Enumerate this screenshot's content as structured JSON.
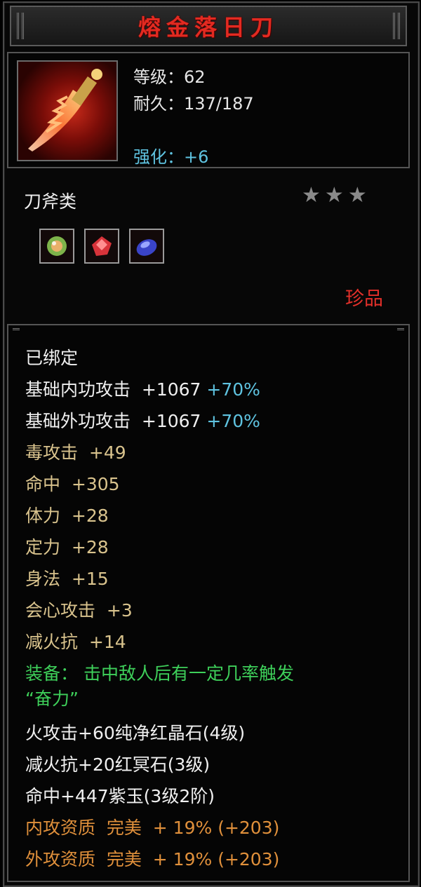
{
  "item": {
    "name": "熔金落日刀",
    "level_line": "等级：62",
    "durability_line": "耐久：137/187",
    "enhance_line": "强化：+6",
    "category": "刀斧类",
    "star_count": 3,
    "rarity": "珍品",
    "gems": [
      {
        "icon": "green-round-gem-icon",
        "color": "#7db34a"
      },
      {
        "icon": "red-crystal-gem-icon",
        "color": "#d8333a"
      },
      {
        "icon": "purple-jade-gem-icon",
        "color": "#4a5be0"
      }
    ]
  },
  "attributes": [
    {
      "text": "已绑定",
      "color": "white"
    },
    {
      "text": "基础内功攻击  +1067",
      "extra": "+70%",
      "color": "white"
    },
    {
      "text": "基础外功攻击  +1067",
      "extra": "+70%",
      "color": "white"
    },
    {
      "text": "毒攻击  +49",
      "color": "tan"
    },
    {
      "text": "命中  +305",
      "color": "tan"
    },
    {
      "text": "体力  +28",
      "color": "tan"
    },
    {
      "text": "定力  +28",
      "color": "tan"
    },
    {
      "text": "身法  +15",
      "color": "tan"
    },
    {
      "text": "会心攻击  +3",
      "color": "tan"
    },
    {
      "text": "减火抗  +14",
      "color": "tan"
    },
    {
      "text": "装备： 击中敌人后有一定几率触发",
      "color": "green"
    },
    {
      "text": "“奋力”",
      "color": "green"
    },
    {
      "text": "火攻击+60纯净红晶石(4级)",
      "color": "white"
    },
    {
      "text": "减火抗+20红冥石(3级)",
      "color": "white"
    },
    {
      "text": "命中+447紫玉(3级2阶)",
      "color": "white"
    },
    {
      "text": "内攻资质  完美  + 19% (+203)",
      "color": "orange"
    },
    {
      "text": "外攻资质  完美  + 19% (+203)",
      "color": "orange"
    }
  ],
  "colors": {
    "title": "#e32a21",
    "enhance": "#5fc3e0",
    "rarity": "#e3302a",
    "effect_green": "#3ed05a",
    "aptitude_orange": "#e0903b"
  }
}
